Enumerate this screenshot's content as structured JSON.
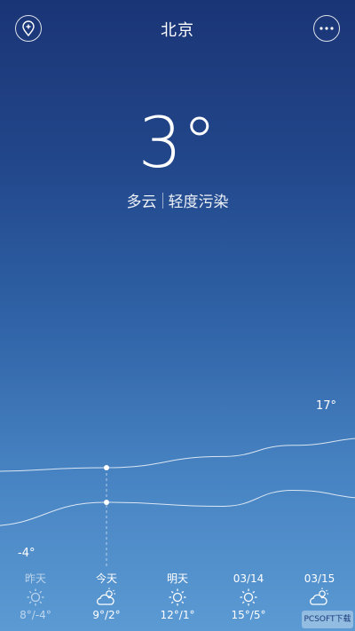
{
  "header": {
    "city": "北京",
    "add_city_icon": "location-plus-icon",
    "more_icon": "more-dots-icon"
  },
  "current": {
    "temperature": "3°",
    "condition": "多云",
    "air_quality": "轻度污染"
  },
  "chart_data": {
    "type": "line",
    "x": [
      "昨天",
      "今天",
      "明天",
      "03/14",
      "03/15"
    ],
    "series": [
      {
        "values": [
          8,
          9,
          12,
          15,
          17
        ]
      },
      {
        "values": [
          -4,
          2,
          1,
          5,
          3
        ]
      }
    ],
    "annotations": {
      "max_label": "17°",
      "min_label": "-4°"
    },
    "today_index": 1
  },
  "forecast": [
    {
      "day": "昨天",
      "icon": "sunny-icon",
      "range": "8°/-4°",
      "past": true
    },
    {
      "day": "今天",
      "icon": "cloudy-sun-icon",
      "range": "9°/2°",
      "past": false
    },
    {
      "day": "明天",
      "icon": "sunny-icon",
      "range": "12°/1°",
      "past": false
    },
    {
      "day": "03/14",
      "icon": "sunny-icon",
      "range": "15°/5°",
      "past": false
    },
    {
      "day": "03/15",
      "icon": "cloudy-sun-icon",
      "range": "",
      "past": false
    }
  ],
  "watermark": "PCSOFT下载"
}
